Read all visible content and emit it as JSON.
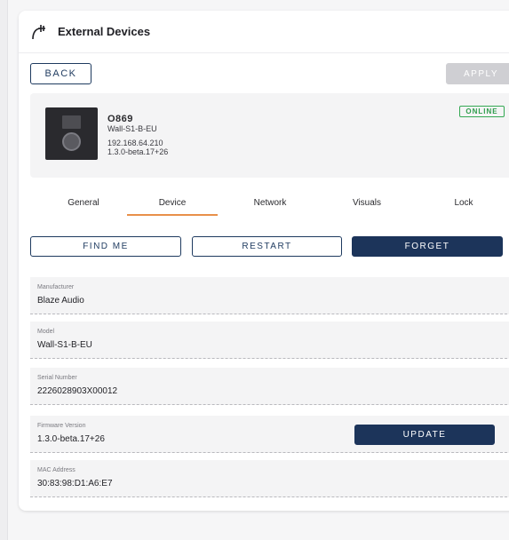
{
  "header": {
    "title": "External Devices",
    "icon": "external-device-icon"
  },
  "toolbar": {
    "back_label": "BACK",
    "apply_label": "APPLY"
  },
  "device": {
    "name": "O869",
    "model": "Wall-S1-B-EU",
    "ip": "192.168.64.210",
    "firmware": "1.3.0-beta.17+26",
    "status": "ONLINE"
  },
  "tabs": [
    {
      "label": "General"
    },
    {
      "label": "Device"
    },
    {
      "label": "Network"
    },
    {
      "label": "Visuals"
    },
    {
      "label": "Lock"
    }
  ],
  "active_tab": "Device",
  "actions": {
    "find_me": "FIND ME",
    "restart": "RESTART",
    "forget": "FORGET"
  },
  "fields": [
    {
      "label": "Manufacturer",
      "value": "Blaze Audio"
    },
    {
      "label": "Model",
      "value": "Wall-S1-B-EU"
    },
    {
      "label": "Serial Number",
      "value": "2226028903X00012"
    },
    {
      "label": "Firmware Version",
      "value": "1.3.0-beta.17+26"
    },
    {
      "label": "MAC Address",
      "value": "30:83:98:D1:A6:E7"
    }
  ],
  "update_label": "UPDATE",
  "colors": {
    "primary": "#1c345a",
    "accent": "#e8904a",
    "online": "#34a853",
    "disabled": "#cfcfd3"
  }
}
